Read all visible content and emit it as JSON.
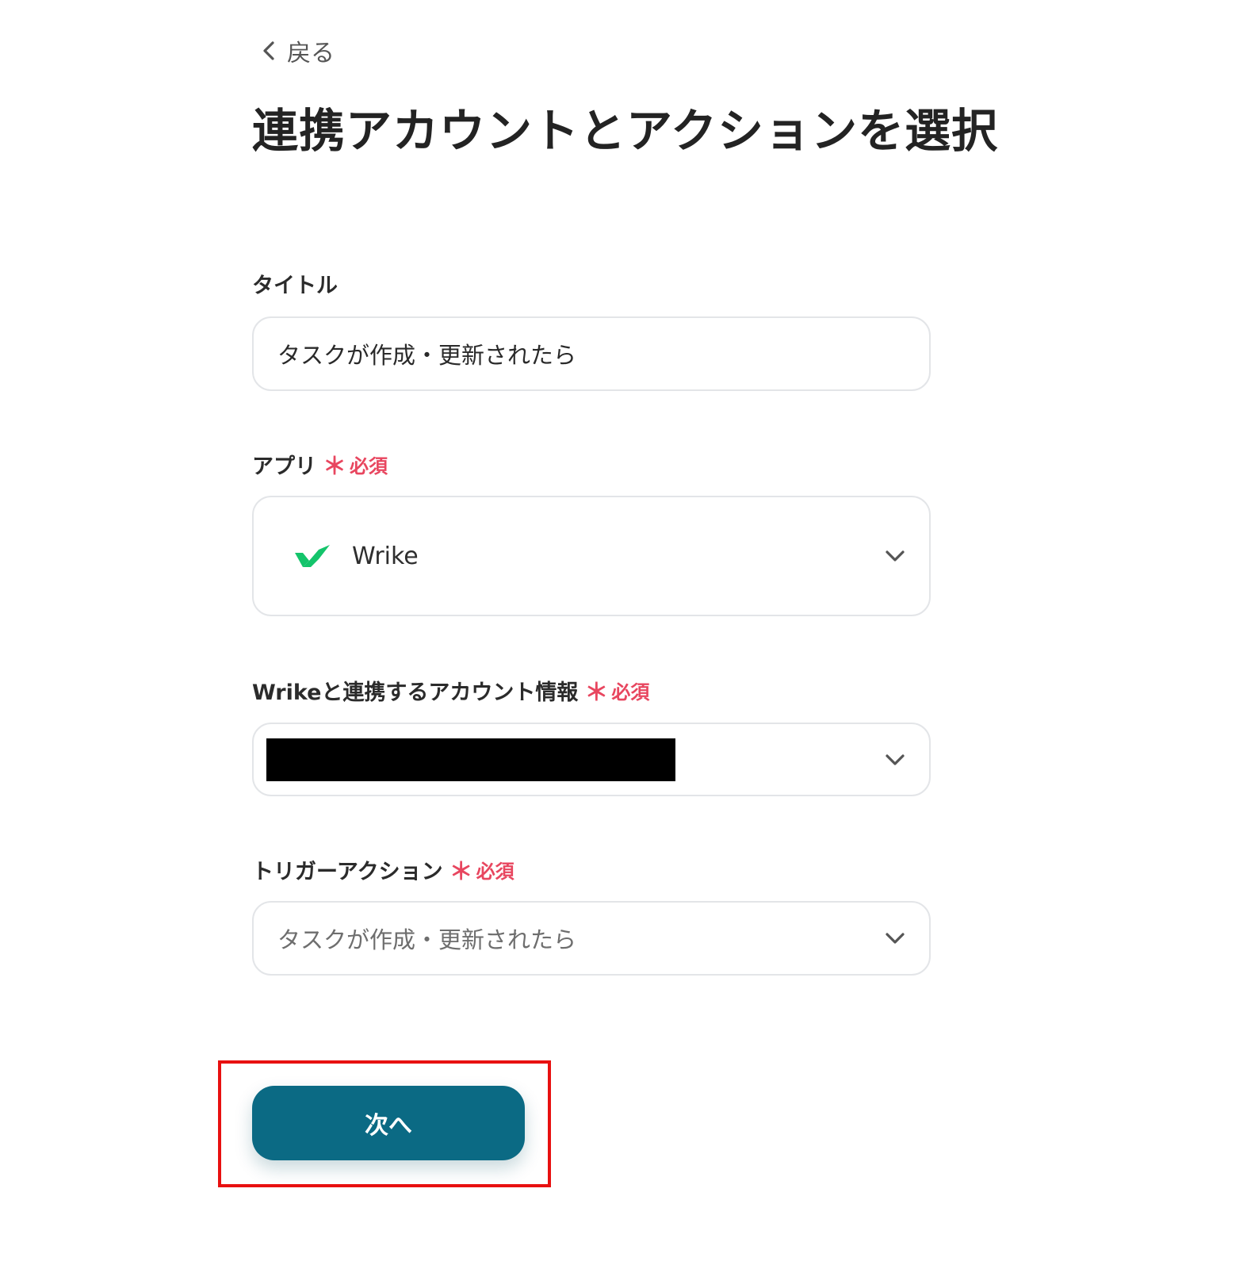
{
  "header": {
    "back_label": "戻る",
    "title": "連携アカウントとアクションを選択"
  },
  "form": {
    "title_field": {
      "label": "タイトル",
      "value": "タスクが作成・更新されたら"
    },
    "app_field": {
      "label": "アプリ",
      "required_mark": "＊",
      "required_text": "必須",
      "value": "Wrike",
      "logo": "wrike-check-icon"
    },
    "account_field": {
      "label": "Wrikeと連携するアカウント情報",
      "required_mark": "＊",
      "required_text": "必須",
      "value_redacted": true
    },
    "trigger_field": {
      "label": "トリガーアクション",
      "required_mark": "＊",
      "required_text": "必須",
      "value": "タスクが作成・更新されたら"
    }
  },
  "actions": {
    "next_label": "次へ"
  },
  "colors": {
    "primary_button": "#0b6a84",
    "required": "#e8465f",
    "highlight": "#e81010",
    "wrike_green": "#14c46b"
  }
}
